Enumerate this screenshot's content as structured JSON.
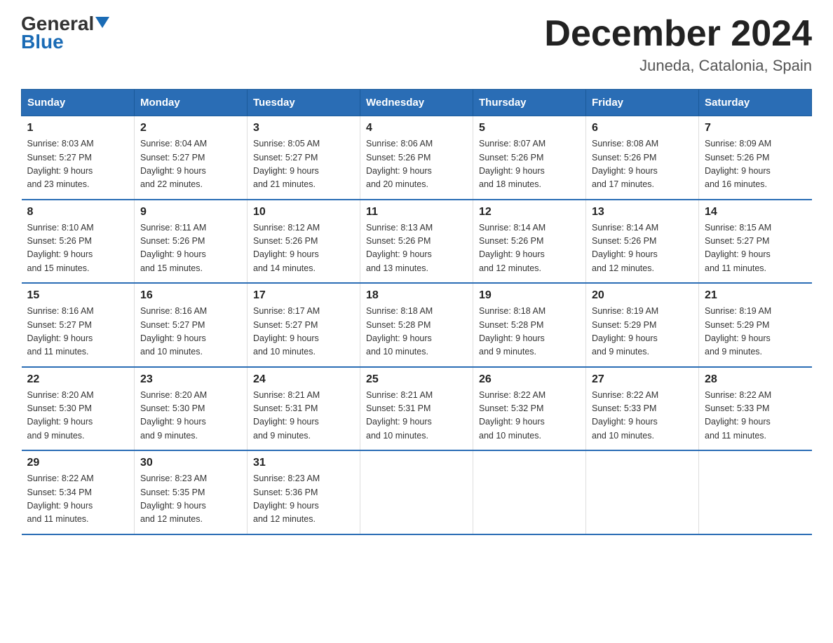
{
  "header": {
    "logo_general": "General",
    "logo_blue": "Blue",
    "month_title": "December 2024",
    "subtitle": "Juneda, Catalonia, Spain"
  },
  "weekdays": [
    "Sunday",
    "Monday",
    "Tuesday",
    "Wednesday",
    "Thursday",
    "Friday",
    "Saturday"
  ],
  "weeks": [
    [
      {
        "day": "1",
        "sunrise": "8:03 AM",
        "sunset": "5:27 PM",
        "daylight": "9 hours and 23 minutes."
      },
      {
        "day": "2",
        "sunrise": "8:04 AM",
        "sunset": "5:27 PM",
        "daylight": "9 hours and 22 minutes."
      },
      {
        "day": "3",
        "sunrise": "8:05 AM",
        "sunset": "5:27 PM",
        "daylight": "9 hours and 21 minutes."
      },
      {
        "day": "4",
        "sunrise": "8:06 AM",
        "sunset": "5:26 PM",
        "daylight": "9 hours and 20 minutes."
      },
      {
        "day": "5",
        "sunrise": "8:07 AM",
        "sunset": "5:26 PM",
        "daylight": "9 hours and 18 minutes."
      },
      {
        "day": "6",
        "sunrise": "8:08 AM",
        "sunset": "5:26 PM",
        "daylight": "9 hours and 17 minutes."
      },
      {
        "day": "7",
        "sunrise": "8:09 AM",
        "sunset": "5:26 PM",
        "daylight": "9 hours and 16 minutes."
      }
    ],
    [
      {
        "day": "8",
        "sunrise": "8:10 AM",
        "sunset": "5:26 PM",
        "daylight": "9 hours and 15 minutes."
      },
      {
        "day": "9",
        "sunrise": "8:11 AM",
        "sunset": "5:26 PM",
        "daylight": "9 hours and 15 minutes."
      },
      {
        "day": "10",
        "sunrise": "8:12 AM",
        "sunset": "5:26 PM",
        "daylight": "9 hours and 14 minutes."
      },
      {
        "day": "11",
        "sunrise": "8:13 AM",
        "sunset": "5:26 PM",
        "daylight": "9 hours and 13 minutes."
      },
      {
        "day": "12",
        "sunrise": "8:14 AM",
        "sunset": "5:26 PM",
        "daylight": "9 hours and 12 minutes."
      },
      {
        "day": "13",
        "sunrise": "8:14 AM",
        "sunset": "5:26 PM",
        "daylight": "9 hours and 12 minutes."
      },
      {
        "day": "14",
        "sunrise": "8:15 AM",
        "sunset": "5:27 PM",
        "daylight": "9 hours and 11 minutes."
      }
    ],
    [
      {
        "day": "15",
        "sunrise": "8:16 AM",
        "sunset": "5:27 PM",
        "daylight": "9 hours and 11 minutes."
      },
      {
        "day": "16",
        "sunrise": "8:16 AM",
        "sunset": "5:27 PM",
        "daylight": "9 hours and 10 minutes."
      },
      {
        "day": "17",
        "sunrise": "8:17 AM",
        "sunset": "5:27 PM",
        "daylight": "9 hours and 10 minutes."
      },
      {
        "day": "18",
        "sunrise": "8:18 AM",
        "sunset": "5:28 PM",
        "daylight": "9 hours and 10 minutes."
      },
      {
        "day": "19",
        "sunrise": "8:18 AM",
        "sunset": "5:28 PM",
        "daylight": "9 hours and 9 minutes."
      },
      {
        "day": "20",
        "sunrise": "8:19 AM",
        "sunset": "5:29 PM",
        "daylight": "9 hours and 9 minutes."
      },
      {
        "day": "21",
        "sunrise": "8:19 AM",
        "sunset": "5:29 PM",
        "daylight": "9 hours and 9 minutes."
      }
    ],
    [
      {
        "day": "22",
        "sunrise": "8:20 AM",
        "sunset": "5:30 PM",
        "daylight": "9 hours and 9 minutes."
      },
      {
        "day": "23",
        "sunrise": "8:20 AM",
        "sunset": "5:30 PM",
        "daylight": "9 hours and 9 minutes."
      },
      {
        "day": "24",
        "sunrise": "8:21 AM",
        "sunset": "5:31 PM",
        "daylight": "9 hours and 9 minutes."
      },
      {
        "day": "25",
        "sunrise": "8:21 AM",
        "sunset": "5:31 PM",
        "daylight": "9 hours and 10 minutes."
      },
      {
        "day": "26",
        "sunrise": "8:22 AM",
        "sunset": "5:32 PM",
        "daylight": "9 hours and 10 minutes."
      },
      {
        "day": "27",
        "sunrise": "8:22 AM",
        "sunset": "5:33 PM",
        "daylight": "9 hours and 10 minutes."
      },
      {
        "day": "28",
        "sunrise": "8:22 AM",
        "sunset": "5:33 PM",
        "daylight": "9 hours and 11 minutes."
      }
    ],
    [
      {
        "day": "29",
        "sunrise": "8:22 AM",
        "sunset": "5:34 PM",
        "daylight": "9 hours and 11 minutes."
      },
      {
        "day": "30",
        "sunrise": "8:23 AM",
        "sunset": "5:35 PM",
        "daylight": "9 hours and 12 minutes."
      },
      {
        "day": "31",
        "sunrise": "8:23 AM",
        "sunset": "5:36 PM",
        "daylight": "9 hours and 12 minutes."
      },
      null,
      null,
      null,
      null
    ]
  ],
  "labels": {
    "sunrise_label": "Sunrise:",
    "sunset_label": "Sunset:",
    "daylight_label": "Daylight:"
  }
}
